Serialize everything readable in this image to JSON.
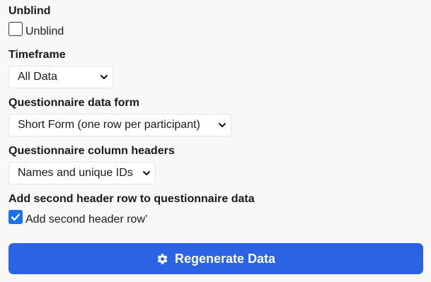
{
  "unblind": {
    "heading": "Unblind",
    "checkbox_label": "Unblind",
    "checked": false
  },
  "timeframe": {
    "heading": "Timeframe",
    "selected": "All Data"
  },
  "data_form": {
    "heading": "Questionnaire data form",
    "selected": "Short Form (one row per participant)"
  },
  "column_headers": {
    "heading": "Questionnaire column headers",
    "selected": "Names and unique IDs"
  },
  "second_header": {
    "heading": "Add second header row to questionnaire data",
    "checkbox_label": "Add second header row’",
    "checked": true
  },
  "regenerate": {
    "label": "Regenerate Data",
    "icon": "gear-icon"
  },
  "colors": {
    "accent": "#2b63e4",
    "checkbox_checked": "#1a73e8",
    "background": "#f8f8f6"
  }
}
